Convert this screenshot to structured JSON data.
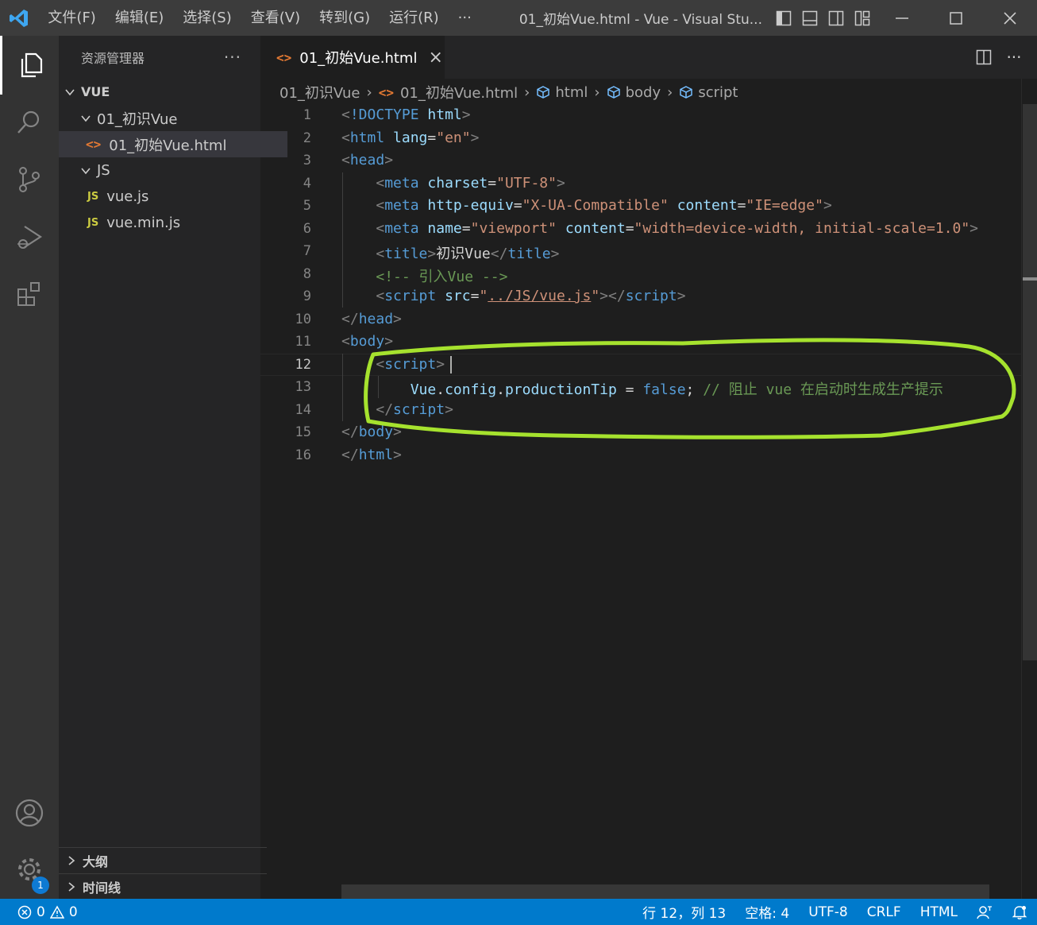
{
  "titlebar": {
    "menu": [
      "文件(F)",
      "编辑(E)",
      "选择(S)",
      "查看(V)",
      "转到(G)",
      "运行(R)",
      "···"
    ],
    "title": "01_初始Vue.html - Vue - Visual Stu..."
  },
  "activitybar": {
    "items": [
      "explorer-icon",
      "search-icon",
      "source-control-icon",
      "run-debug-icon",
      "extensions-icon"
    ],
    "bottom": [
      "accounts-icon",
      "settings-gear-icon"
    ],
    "settings_badge": "1"
  },
  "sidebar": {
    "title": "资源管理器",
    "more": "···",
    "root": "VUE",
    "tree": [
      {
        "label": "01_初识Vue",
        "type": "folder",
        "depth": 1
      },
      {
        "label": "01_初始Vue.html",
        "type": "html",
        "depth": 2
      },
      {
        "label": "JS",
        "type": "folder",
        "depth": 1
      },
      {
        "label": "vue.js",
        "type": "js",
        "depth": 2
      },
      {
        "label": "vue.min.js",
        "type": "js",
        "depth": 2
      }
    ],
    "js_icon_text": "JS",
    "html_icon_text": "<>",
    "panels": [
      "大纲",
      "时间线"
    ]
  },
  "tabs": {
    "active_label": "01_初始Vue.html",
    "close": "×"
  },
  "breadcrumb": {
    "items": [
      "01_初识Vue",
      "01_初始Vue.html",
      "html",
      "body",
      "script"
    ]
  },
  "editor": {
    "line_numbers": [
      "1",
      "2",
      "3",
      "4",
      "5",
      "6",
      "7",
      "8",
      "9",
      "10",
      "11",
      "12",
      "13",
      "14",
      "15",
      "16"
    ],
    "current_line": "12",
    "annotation_color": "#a6e22e"
  },
  "statusbar": {
    "errors": "0",
    "warnings": "0",
    "position": "行 12，列 13",
    "spaces": "空格: 4",
    "encoding": "UTF-8",
    "eol": "CRLF",
    "language": "HTML"
  },
  "colors": {
    "accent": "#007acc",
    "editor_bg": "#1e1e1e",
    "sidebar_bg": "#252526"
  }
}
